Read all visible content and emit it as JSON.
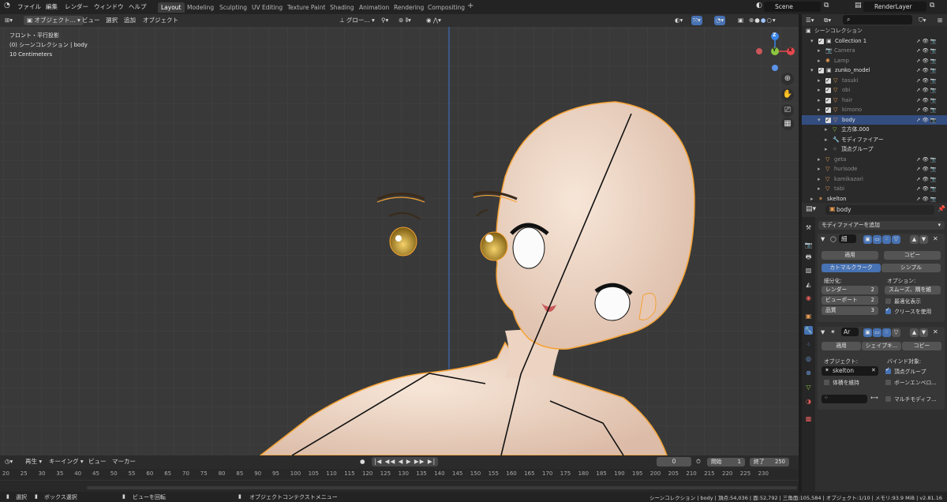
{
  "topbar": {
    "menus": [
      "ファイル",
      "編集",
      "レンダー",
      "ウィンドウ",
      "ヘルプ"
    ],
    "workspaces": [
      "Layout",
      "Modeling",
      "Sculpting",
      "UV Editing",
      "Texture Paint",
      "Shading",
      "Animation",
      "Rendering",
      "Compositing"
    ],
    "active_workspace": "Layout",
    "add_tab": "+",
    "scene": "Scene",
    "view_layer": "RenderLayer"
  },
  "viewport_header": {
    "mode": "オブジェクト...",
    "menus": [
      "ビュー",
      "選択",
      "追加",
      "オブジェクト"
    ],
    "orientation": "グロー..."
  },
  "viewport_overlay": {
    "view_name": "フロント・平行投影",
    "collection_info": "(0) シーンコレクション | body",
    "scale": "10 Centimeters"
  },
  "gizmo": {
    "z": "Z",
    "y": "Y",
    "x": "X"
  },
  "timeline": {
    "menus": [
      "再生",
      "キーイング",
      "ビュー",
      "マーカー"
    ],
    "current_frame": "0",
    "start_label": "開始",
    "start": "1",
    "end_label": "終了",
    "end": "250",
    "ticks": [
      "20",
      "25",
      "30",
      "35",
      "40",
      "45",
      "50",
      "55",
      "60",
      "65",
      "70",
      "75",
      "80",
      "85",
      "90",
      "95",
      "100",
      "105",
      "110",
      "115",
      "120",
      "125",
      "130",
      "135",
      "140",
      "145",
      "150",
      "155",
      "160",
      "165",
      "170",
      "175",
      "180",
      "185",
      "190",
      "195",
      "200",
      "205",
      "210",
      "215",
      "220",
      "225",
      "230"
    ]
  },
  "status": {
    "select": "選択",
    "box_select": "ボックス選択",
    "rotate": "ビューを回転",
    "context_menu": "オブジェクトコンテクストメニュー",
    "stats": "シーンコレクション | body | 頂点:54,036 | 面:52,792 | 三角面:105,584 | オブジェクト:1/10 | メモリ:93.9 MiB | v2.81.16"
  },
  "outliner": {
    "header_title": "シーンコレクション",
    "rows": [
      {
        "name": "Collection 1",
        "indent": 1,
        "kind": "collection"
      },
      {
        "name": "Camera",
        "indent": 2,
        "kind": "camera",
        "dim": true
      },
      {
        "name": "Lamp",
        "indent": 2,
        "kind": "light",
        "dim": true
      },
      {
        "name": "zunko_model",
        "indent": 1,
        "kind": "collection"
      },
      {
        "name": "tasuki",
        "indent": 2,
        "kind": "mesh",
        "dim": true
      },
      {
        "name": "obi",
        "indent": 2,
        "kind": "mesh",
        "dim": true
      },
      {
        "name": "hair",
        "indent": 2,
        "kind": "mesh",
        "dim": true
      },
      {
        "name": "kimono",
        "indent": 2,
        "kind": "mesh",
        "dim": true
      },
      {
        "name": "body",
        "indent": 2,
        "kind": "mesh",
        "selected": true
      },
      {
        "name": "立方体.000",
        "indent": 3,
        "kind": "meshdata"
      },
      {
        "name": "モディファイアー",
        "indent": 3,
        "kind": "modifier"
      },
      {
        "name": "頂点グループ",
        "indent": 3,
        "kind": "vgroup"
      },
      {
        "name": "geta",
        "indent": 2,
        "kind": "mesh",
        "dim": true
      },
      {
        "name": "hurisode",
        "indent": 2,
        "kind": "mesh",
        "dim": true
      },
      {
        "name": "kamikazari",
        "indent": 2,
        "kind": "mesh",
        "dim": true
      },
      {
        "name": "tabi",
        "indent": 2,
        "kind": "mesh",
        "dim": true
      },
      {
        "name": "skelton",
        "indent": 1,
        "kind": "armature"
      }
    ]
  },
  "properties": {
    "object_name": "body",
    "add_modifier": "モディファイアーを追加",
    "subsurf": {
      "name": "細",
      "apply": "適用",
      "copy": "コピー",
      "catmull": "カトマルクラーク",
      "simple": "シンプル",
      "subdiv_label": "細分化:",
      "render_label": "レンダー",
      "render_val": "2",
      "viewport_label": "ビューポート",
      "viewport_val": "2",
      "quality_label": "品質",
      "quality_val": "3",
      "options_label": "オプション:",
      "uv_smooth": "スムーズ、隅を維",
      "optimal_display": "最適化表示",
      "use_creases": "クリースを使用"
    },
    "armature": {
      "name": "Ar",
      "apply": "適用",
      "shapekey": "シェイプキ...",
      "copy": "コピー",
      "object_label": "オブジェクト:",
      "object": "skelton",
      "preserve_volume": "体積を維持",
      "bind_label": "バインド対象:",
      "vertex_groups": "頂点グループ",
      "bone_envelopes": "ボーンエンベロ...",
      "multi_modifier": "マルチモディフ..."
    }
  },
  "colors": {
    "accent": "#4772b3",
    "selected_outline": "#f5a234",
    "skin": "#f1d9c7",
    "mesh_icon": "#e49b54",
    "gizmo_x": "#e5484d",
    "gizmo_y": "#8cc640",
    "gizmo_z": "#3b85e8"
  }
}
